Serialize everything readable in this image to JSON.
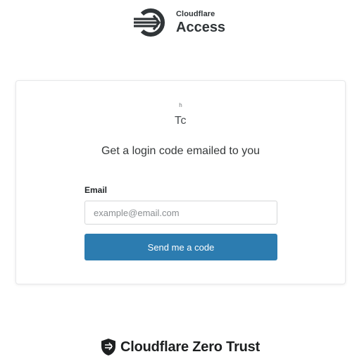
{
  "header": {
    "brand_small": "Cloudflare",
    "brand_large": "Access",
    "logo_icon": "cloudflare-access-icon"
  },
  "card": {
    "team_initial": "h",
    "team_name": "Tc",
    "heading": "Get a login code emailed to you",
    "email_label": "Email",
    "email_placeholder": "example@email.com",
    "email_value": "",
    "submit_label": "Send me a code"
  },
  "footer": {
    "text": "Cloudflare Zero Trust",
    "logo_icon": "shield-icon"
  },
  "colors": {
    "button_bg": "#2c7cb0",
    "text_dark": "#303538",
    "card_border": "#e7e8ea"
  }
}
